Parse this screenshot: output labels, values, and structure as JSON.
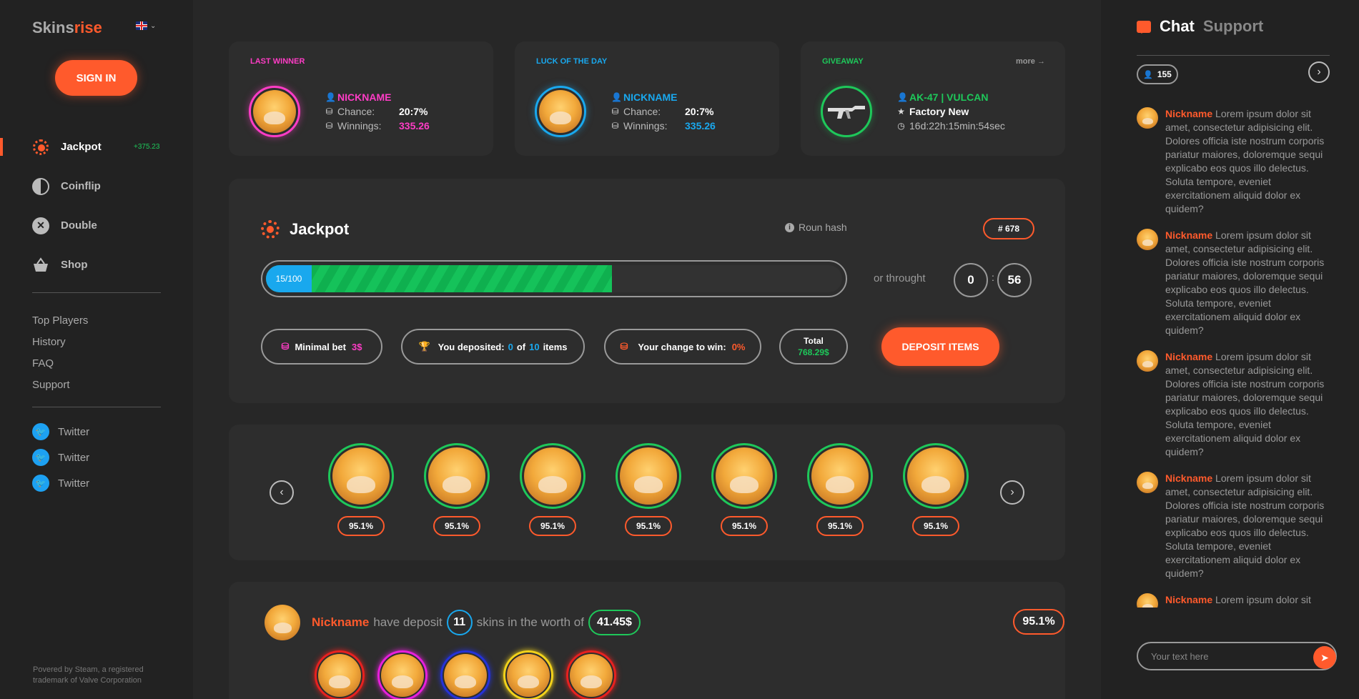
{
  "brand": {
    "name_part1": "Skins",
    "name_part2": "rise",
    "accent": "#ff5a2c"
  },
  "language": {
    "flag": "uk-flag-icon",
    "chevron": "⌄"
  },
  "signin_label": "SIGN IN",
  "nav": [
    {
      "label": "Jackpot",
      "badge": "+375.23",
      "icon": "jackpot-icon",
      "active": true
    },
    {
      "label": "Coinflip",
      "icon": "coinflip-icon"
    },
    {
      "label": "Double",
      "icon": "double-icon"
    },
    {
      "label": "Shop",
      "icon": "shop-basket-icon"
    }
  ],
  "links": [
    "Top Players",
    "History",
    "FAQ",
    "Support"
  ],
  "social": [
    "Twitter",
    "Twitter",
    "Twitter"
  ],
  "footer": "Povered by Steam, a registered trademark of Valve Corporation",
  "last_winner": {
    "title": "LAST WINNER",
    "nickname": "NICKNAME",
    "chance_label": "Chance:",
    "chance": "20:7%",
    "winnings_label": "Winnings:",
    "winnings": "335.26",
    "color": "#ff3cc6"
  },
  "luck_of_day": {
    "title": "LUCK OF THE DAY",
    "nickname": "NICKNAME",
    "chance_label": "Chance:",
    "chance": "20:7%",
    "winnings_label": "Winnings:",
    "winnings": "335.26",
    "color": "#19a8ee"
  },
  "giveaway": {
    "title": "GIVEAWAY",
    "more": "more →",
    "item": "AK-47 | VULCAN",
    "condition": "Factory New",
    "timer": "16d:22h:15min:54sec",
    "color": "#1ec85a"
  },
  "jackpot": {
    "title": "Jackpot",
    "hash_label": "Roun hash",
    "round": "# 678",
    "progress_label": "15/100",
    "progress_fraction": 0.6,
    "or_through": "or throught",
    "timer_min": "0",
    "timer_sep": ":",
    "timer_sec": "56",
    "min_bet_label": "Minimal bet",
    "min_bet_value": "3$",
    "deposited_label": "You deposited:",
    "deposited_count": "0",
    "deposited_of": "of",
    "deposited_max": "10",
    "deposited_items": "items",
    "chance_label": "Your change to win:",
    "chance_value": "0%",
    "total_label": "Total",
    "total_value": "768.29$",
    "deposit_button": "DEPOSIT ITEMS"
  },
  "players": [
    "95.1%",
    "95.1%",
    "95.1%",
    "95.1%",
    "95.1%",
    "95.1%",
    "95.1%"
  ],
  "deposit": {
    "nickname": "Nickname",
    "text1": "have deposit",
    "count": "11",
    "text2": "skins in the worth of",
    "worth": "41.45$",
    "percent": "95.1%",
    "item_colors": [
      "#e8211f",
      "#e81fdc",
      "#2532d8",
      "#f2d21a",
      "#e8211f"
    ]
  },
  "chat": {
    "tab_chat": "Chat",
    "tab_support": "Support",
    "online": "155",
    "placeholder": "Your text here",
    "messages": [
      {
        "nick": "Nickname",
        "text": "Lorem ipsum dolor sit amet, consectetur adipisicing elit. Dolores officia iste nostrum corporis pariatur maiores, doloremque sequi explicabo eos quos illo delectus. Soluta tempore, eveniet exercitationem aliquid dolor ex quidem?"
      },
      {
        "nick": "Nickname",
        "text": "Lorem ipsum dolor sit amet, consectetur adipisicing elit. Dolores officia iste nostrum corporis pariatur maiores, doloremque sequi explicabo eos quos illo delectus. Soluta tempore, eveniet exercitationem aliquid dolor ex quidem?"
      },
      {
        "nick": "Nickname",
        "text": "Lorem ipsum dolor sit amet, consectetur adipisicing elit. Dolores officia iste nostrum corporis pariatur maiores, doloremque sequi explicabo eos quos illo delectus. Soluta tempore, eveniet exercitationem aliquid dolor ex quidem?"
      },
      {
        "nick": "Nickname",
        "text": "Lorem ipsum dolor sit amet, consectetur adipisicing elit. Dolores officia iste nostrum corporis pariatur maiores, doloremque sequi explicabo eos quos illo delectus. Soluta tempore, eveniet exercitationem aliquid dolor ex quidem?"
      },
      {
        "nick": "Nickname",
        "text": "Lorem ipsum dolor sit amet, consectetur adipisicing elit. Dolores officia iste nostrum corporis pariatur maiores, doloremque sequi explicabo eos quos illo delectus. Soluta tempore, eveniet exercitationem aliquid dolor ex quidem?"
      }
    ]
  }
}
